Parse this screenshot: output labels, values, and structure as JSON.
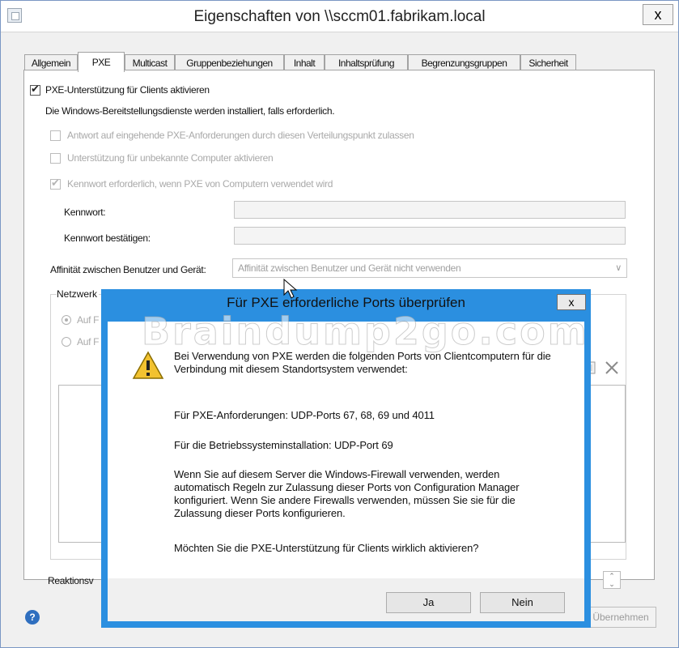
{
  "window": {
    "title": "Eigenschaften von \\\\sccm01.fabrikam.local",
    "close_label": "x"
  },
  "tabs": [
    {
      "label": "Allgemein",
      "active": false
    },
    {
      "label": "PXE",
      "active": true
    },
    {
      "label": "Multicast",
      "active": false
    },
    {
      "label": "Gruppenbeziehungen",
      "active": false
    },
    {
      "label": "Inhalt",
      "active": false
    },
    {
      "label": "Inhaltsprüfung",
      "active": false
    },
    {
      "label": "Begrenzungsgruppen",
      "active": false
    },
    {
      "label": "Sicherheit",
      "active": false
    }
  ],
  "pxe": {
    "enable_pxe": {
      "label": "PXE-Unterstützung für Clients aktivieren",
      "checked": true
    },
    "install_note": "Die Windows-Bereitstellungsdienste werden installiert, falls erforderlich.",
    "respond_requests": {
      "label": "Antwort auf eingehende PXE-Anforderungen durch diesen Verteilungspunkt zulassen",
      "checked": false
    },
    "unknown_computers": {
      "label": "Unterstützung für unbekannte Computer aktivieren",
      "checked": false
    },
    "require_password": {
      "label": "Kennwort erforderlich, wenn PXE von Computern verwendet wird",
      "checked": true
    },
    "password_label": "Kennwort:",
    "confirm_password_label": "Kennwort bestätigen:",
    "affinity_label": "Affinität zwischen Benutzer und Gerät:",
    "affinity_value": "Affinität zwischen Benutzer und Gerät nicht verwenden",
    "network_group_label": "Netzwerk",
    "radio1_label": "Auf F",
    "radio2_label": "Auf F",
    "response_label": "Reaktionsv"
  },
  "footer": {
    "apply_label": "Übernehmen",
    "help_icon": "?"
  },
  "dialog": {
    "title": "Für PXE erforderliche Ports überprüfen",
    "close_label": "x",
    "intro": "Bei Verwendung von PXE werden die folgenden Ports von Clientcomputern für die Verbindung mit diesem Standortsystem verwendet:",
    "line_requests": "Für PXE-Anforderungen: UDP-Ports 67, 68, 69 und 4011",
    "line_os_install": "Für die Betriebssysteminstallation: UDP-Port 69",
    "firewall_note": "Wenn Sie auf diesem Server die Windows-Firewall verwenden, werden automatisch Regeln zur Zulassung dieser Ports von Configuration Manager konfiguriert. Wenn Sie andere Firewalls verwenden, müssen Sie sie für die Zulassung dieser Ports konfigurieren.",
    "question": "Möchten Sie die PXE-Unterstützung für Clients wirklich aktivieren?",
    "yes_label": "Ja",
    "no_label": "Nein"
  },
  "watermark": "Braindump2go.com",
  "colors": {
    "dialog_frame": "#2b8fe0",
    "window_border": "#7a97c4",
    "disabled_text": "#a9a9a9"
  }
}
